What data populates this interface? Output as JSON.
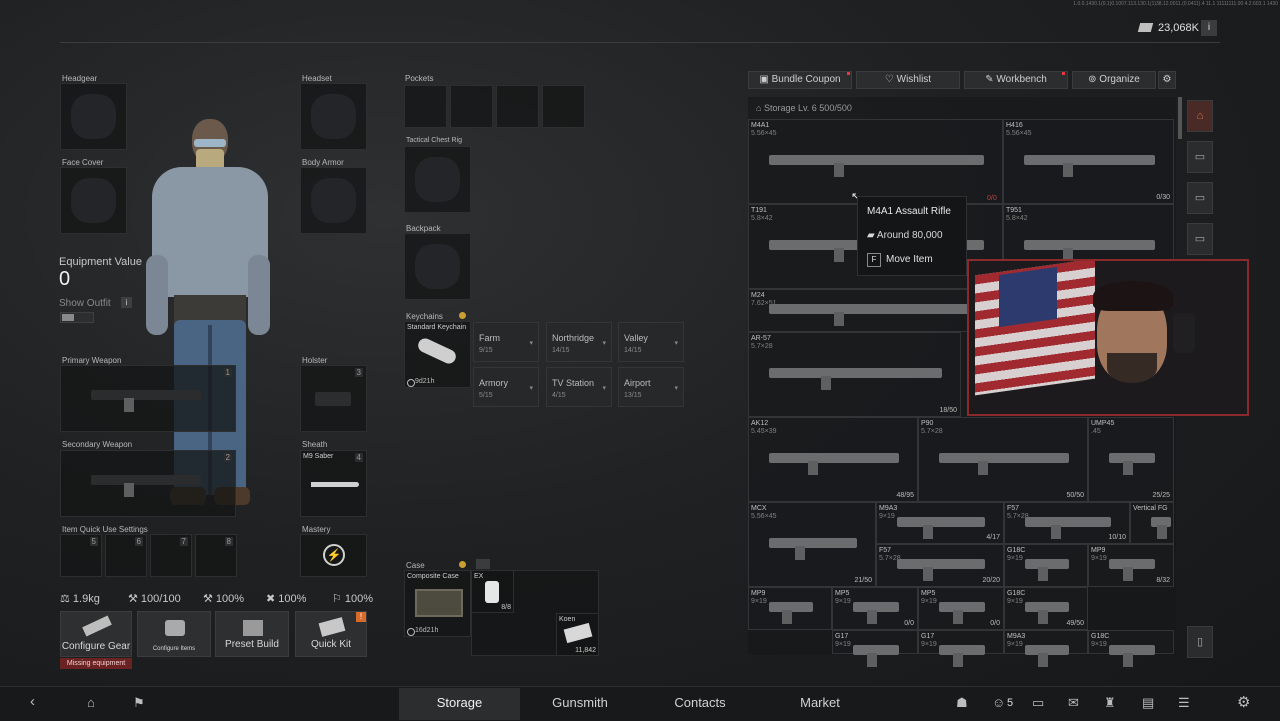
{
  "header": {
    "build_string": "1.0.0.1430.1(0.1)0.1007.113.130.1(1)38.12.0011.(0.0411).4 11.1 11111111.00 4.2.603.1 1430",
    "currency_value": "23,068K",
    "info_icon": "i"
  },
  "equipment": {
    "headgear": "Headgear",
    "headset": "Headset",
    "face_cover": "Face Cover",
    "body_armor": "Body Armor",
    "equipment_value_label": "Equipment Value",
    "equipment_value": "0",
    "show_outfit": "Show Outfit",
    "info": "i",
    "primary_weapon": "Primary Weapon",
    "primary_num": "1",
    "holster": "Holster",
    "holster_num": "3",
    "secondary_weapon": "Secondary Weapon",
    "secondary_num": "2",
    "sheath": "Sheath",
    "sheath_item": "M9 Saber",
    "sheath_num": "4",
    "quick_use": "Item Quick Use Settings",
    "quick_nums": [
      "5",
      "6",
      "7",
      "8"
    ],
    "mastery": "Mastery"
  },
  "stats": {
    "weight": "1.9kg",
    "durability": "100/100",
    "s1": "100%",
    "s2": "100%",
    "s3": "100%"
  },
  "actions": {
    "configure_gear": "Configure Gear",
    "missing": "Missing equipment",
    "configure_items": "Configure Items",
    "preset_build": "Preset Build",
    "quick_kit": "Quick Kit",
    "quick_kit_badge": "!"
  },
  "mid": {
    "pockets": "Pockets",
    "tactical": "Tactical Chest Rig",
    "backpack": "Backpack",
    "keychains": "Keychains",
    "standard_keychain": "Standard Keychain",
    "keychain_timer": "9d21h",
    "keychain_slots": [
      {
        "name": "Farm",
        "count": "9/15"
      },
      {
        "name": "Northridge",
        "count": "14/15"
      },
      {
        "name": "Valley",
        "count": "14/15"
      },
      {
        "name": "Armory",
        "count": "5/15"
      },
      {
        "name": "TV Station",
        "count": "4/15"
      },
      {
        "name": "Airport",
        "count": "13/15"
      }
    ],
    "case": "Case",
    "composite_case": "Composite Case",
    "case_timer": "16d21h",
    "case_item1": "EX",
    "case_item1_count": "8/8",
    "case_item2": "Koen",
    "case_item2_count": "11,842"
  },
  "storage_tabs": {
    "bundle": "Bundle Coupon",
    "wishlist": "Wishlist",
    "workbench": "Workbench",
    "organize": "Organize"
  },
  "storage": {
    "title": "Storage Lv. 6 500/500",
    "weapons": [
      {
        "name": "M4A1",
        "cal": "5.56×45",
        "count": ""
      },
      {
        "name": "H416",
        "cal": "5.56×45",
        "count": "0/30"
      },
      {
        "name": "T191",
        "cal": "5.8×42",
        "count": ""
      },
      {
        "name": "T951",
        "cal": "5.8×42",
        "count": ""
      },
      {
        "name": "M24",
        "cal": "7.62×51",
        "count": ""
      },
      {
        "name": "AR-57",
        "cal": "5.7×28",
        "count": "18/50"
      },
      {
        "name": "AK12",
        "cal": "5.45×39",
        "count": "48/95"
      },
      {
        "name": "P90",
        "cal": "5.7×28",
        "count": "50/50"
      },
      {
        "name": "UMP45",
        "cal": ".45",
        "count": "25/25"
      },
      {
        "name": "MCX",
        "cal": "5.56×45",
        "count": "21/50"
      },
      {
        "name": "M9A3",
        "cal": "9×19",
        "count": "4/17"
      },
      {
        "name": "F57",
        "cal": "5.7×28",
        "count": "10/10"
      },
      {
        "name": "Vertical FG",
        "cal": "",
        "count": ""
      },
      {
        "name": "F57",
        "cal": "5.7×28",
        "count": "20/20"
      },
      {
        "name": "G18C",
        "cal": "9×19",
        "count": ""
      },
      {
        "name": "MP9",
        "cal": "9×19",
        "count": "8/32"
      },
      {
        "name": "MP9",
        "cal": "9×19",
        "count": ""
      },
      {
        "name": "MP5",
        "cal": "9×19",
        "count": "0/0"
      },
      {
        "name": "MP5",
        "cal": "9×19",
        "count": "0/0"
      },
      {
        "name": "G18C",
        "cal": "9×19",
        "count": "49/50"
      },
      {
        "name": "G17",
        "cal": "9×19",
        "count": ""
      },
      {
        "name": "G17",
        "cal": "9×19",
        "count": ""
      },
      {
        "name": "M9A3",
        "cal": "9×19",
        "count": ""
      },
      {
        "name": "G18C",
        "cal": "9×19",
        "count": ""
      }
    ],
    "red_count": "0/0"
  },
  "tooltip": {
    "title": "M4A1 Assault Rifle",
    "price": "Around 80,000",
    "key": "F",
    "action": "Move Item"
  },
  "bottom_nav": {
    "storage": "Storage",
    "gunsmith": "Gunsmith",
    "contacts": "Contacts",
    "market": "Market",
    "friends_count": "5"
  }
}
